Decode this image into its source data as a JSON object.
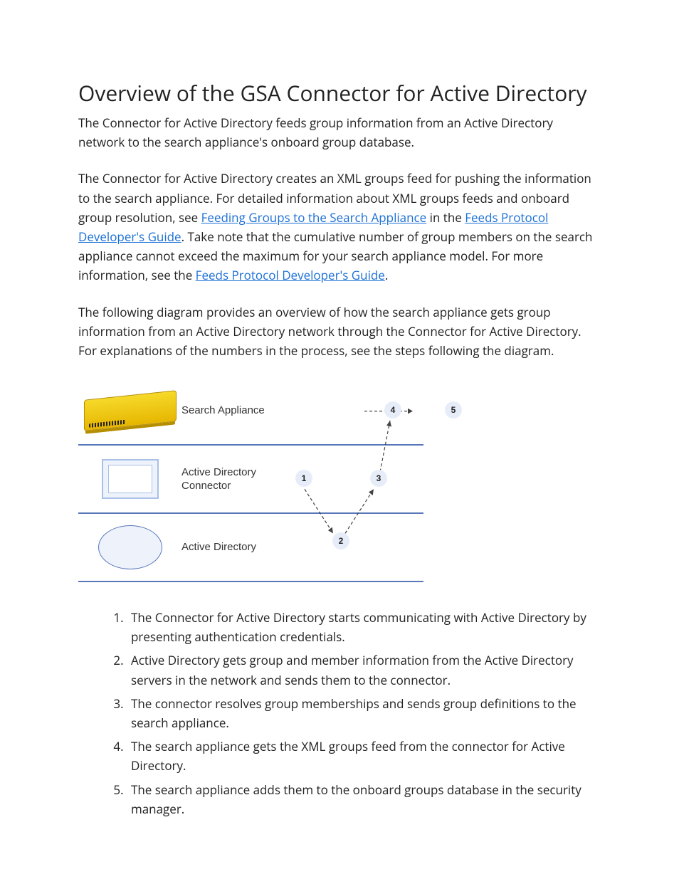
{
  "title": "Overview of the GSA Connector for Active Directory",
  "intro": "The Connector for Active Directory feeds group information from an Active Directory network to the search appliance's onboard group database.",
  "para2": {
    "pre": "The Connector for Active Directory creates an XML groups feed for pushing the information to the search appliance. For detailed information about XML groups feeds and onboard group resolution, see ",
    "link1": "Feeding Groups to the Search Appliance",
    "mid1": " in the ",
    "link2": "Feeds Protocol Developer's Guide",
    "mid2": ". Take note that the cumulative number of group members on the search appliance cannot exceed the maximum for your search appliance model. For more information, see the ",
    "link3": "Feeds Protocol Developer's Guide",
    "end": "."
  },
  "para3": "The following diagram provides an overview of how the search appliance gets group information from an Active Directory network through the Connector for Active Directory. For explanations of the numbers in the process, see the steps following the diagram.",
  "diagram": {
    "row1_label": "Search Appliance",
    "row2_label": "Active Directory Connector",
    "row3_label": "Active Directory",
    "nodes": {
      "n1": "1",
      "n2": "2",
      "n3": "3",
      "n4": "4",
      "n5": "5"
    }
  },
  "steps": [
    "The Connector for Active Directory starts communicating with Active Directory by presenting authentication credentials.",
    "Active Directory gets group and member information from the Active Directory servers in the network and sends them to the connector.",
    "The connector resolves group memberships and sends group definitions to the search appliance.",
    "The search appliance gets the XML groups feed from the connector for Active Directory.",
    "The search appliance adds them to the onboard groups database in the security manager."
  ]
}
